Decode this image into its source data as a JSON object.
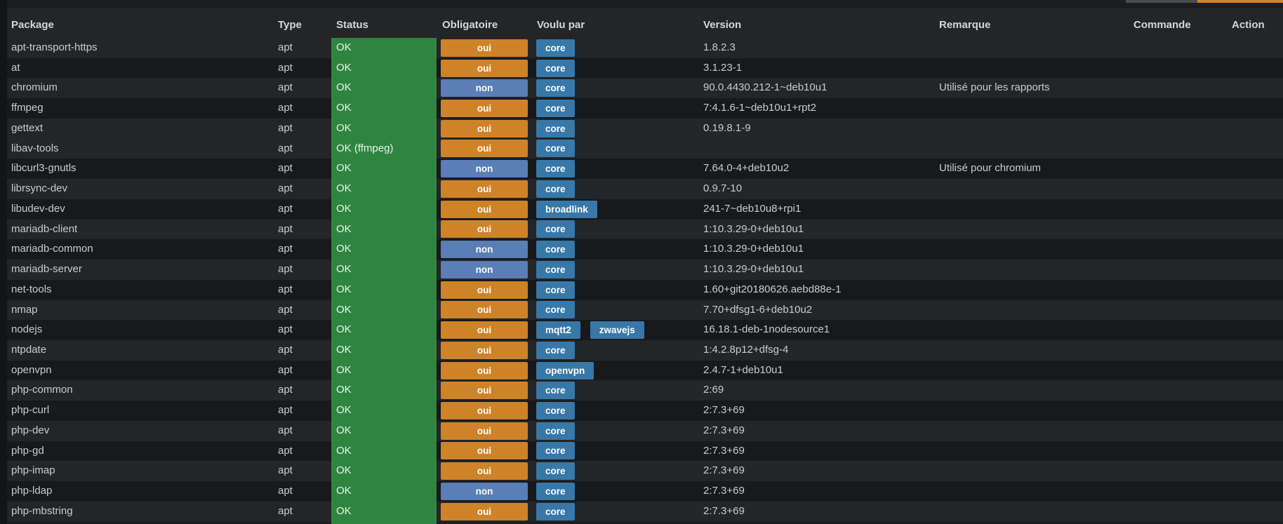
{
  "toolbar": {
    "gray_button_color": "#4a4c4e",
    "orange_button_color": "#cf8228"
  },
  "colors": {
    "page_background": "#131517",
    "table_background": "#1b1d1f",
    "row_light": "#232527",
    "row_dark": "#17191b",
    "status_ok_green": "#2f8540",
    "badge_oui_orange": "#ce8329",
    "badge_non_blue": "#5a7eb5",
    "badge_wanted_blue": "#3878a8",
    "text": "#c9cbce",
    "header_text": "#d4d6d8"
  },
  "table": {
    "columns": [
      {
        "key": "package",
        "label": "Package"
      },
      {
        "key": "type",
        "label": "Type"
      },
      {
        "key": "status",
        "label": "Status"
      },
      {
        "key": "obligatoire",
        "label": "Obligatoire"
      },
      {
        "key": "voulu_par",
        "label": "Voulu par"
      },
      {
        "key": "version",
        "label": "Version"
      },
      {
        "key": "remarque",
        "label": "Remarque"
      },
      {
        "key": "commande",
        "label": "Commande"
      },
      {
        "key": "action",
        "label": "Action"
      }
    ],
    "rows": [
      {
        "package": "apt-transport-https",
        "type": "apt",
        "status": "OK",
        "obligatoire": "oui",
        "voulu_par": [
          "core"
        ],
        "version": "1.8.2.3",
        "remarque": "",
        "commande": "",
        "action": ""
      },
      {
        "package": "at",
        "type": "apt",
        "status": "OK",
        "obligatoire": "oui",
        "voulu_par": [
          "core"
        ],
        "version": "3.1.23-1",
        "remarque": "",
        "commande": "",
        "action": ""
      },
      {
        "package": "chromium",
        "type": "apt",
        "status": "OK",
        "obligatoire": "non",
        "voulu_par": [
          "core"
        ],
        "version": "90.0.4430.212-1~deb10u1",
        "remarque": "Utilisé pour les rapports",
        "commande": "",
        "action": ""
      },
      {
        "package": "ffmpeg",
        "type": "apt",
        "status": "OK",
        "obligatoire": "oui",
        "voulu_par": [
          "core"
        ],
        "version": "7:4.1.6-1~deb10u1+rpt2",
        "remarque": "",
        "commande": "",
        "action": ""
      },
      {
        "package": "gettext",
        "type": "apt",
        "status": "OK",
        "obligatoire": "oui",
        "voulu_par": [
          "core"
        ],
        "version": "0.19.8.1-9",
        "remarque": "",
        "commande": "",
        "action": ""
      },
      {
        "package": "libav-tools",
        "type": "apt",
        "status": "OK (ffmpeg)",
        "obligatoire": "oui",
        "voulu_par": [
          "core"
        ],
        "version": "",
        "remarque": "",
        "commande": "",
        "action": ""
      },
      {
        "package": "libcurl3-gnutls",
        "type": "apt",
        "status": "OK",
        "obligatoire": "non",
        "voulu_par": [
          "core"
        ],
        "version": "7.64.0-4+deb10u2",
        "remarque": "Utilisé pour chromium",
        "commande": "",
        "action": ""
      },
      {
        "package": "librsync-dev",
        "type": "apt",
        "status": "OK",
        "obligatoire": "oui",
        "voulu_par": [
          "core"
        ],
        "version": "0.9.7-10",
        "remarque": "",
        "commande": "",
        "action": ""
      },
      {
        "package": "libudev-dev",
        "type": "apt",
        "status": "OK",
        "obligatoire": "oui",
        "voulu_par": [
          "broadlink"
        ],
        "version": "241-7~deb10u8+rpi1",
        "remarque": "",
        "commande": "",
        "action": ""
      },
      {
        "package": "mariadb-client",
        "type": "apt",
        "status": "OK",
        "obligatoire": "oui",
        "voulu_par": [
          "core"
        ],
        "version": "1:10.3.29-0+deb10u1",
        "remarque": "",
        "commande": "",
        "action": ""
      },
      {
        "package": "mariadb-common",
        "type": "apt",
        "status": "OK",
        "obligatoire": "non",
        "voulu_par": [
          "core"
        ],
        "version": "1:10.3.29-0+deb10u1",
        "remarque": "",
        "commande": "",
        "action": ""
      },
      {
        "package": "mariadb-server",
        "type": "apt",
        "status": "OK",
        "obligatoire": "non",
        "voulu_par": [
          "core"
        ],
        "version": "1:10.3.29-0+deb10u1",
        "remarque": "",
        "commande": "",
        "action": ""
      },
      {
        "package": "net-tools",
        "type": "apt",
        "status": "OK",
        "obligatoire": "oui",
        "voulu_par": [
          "core"
        ],
        "version": "1.60+git20180626.aebd88e-1",
        "remarque": "",
        "commande": "",
        "action": ""
      },
      {
        "package": "nmap",
        "type": "apt",
        "status": "OK",
        "obligatoire": "oui",
        "voulu_par": [
          "core"
        ],
        "version": "7.70+dfsg1-6+deb10u2",
        "remarque": "",
        "commande": "",
        "action": ""
      },
      {
        "package": "nodejs",
        "type": "apt",
        "status": "OK",
        "obligatoire": "oui",
        "voulu_par": [
          "mqtt2",
          "zwavejs"
        ],
        "version": "16.18.1-deb-1nodesource1",
        "remarque": "",
        "commande": "",
        "action": ""
      },
      {
        "package": "ntpdate",
        "type": "apt",
        "status": "OK",
        "obligatoire": "oui",
        "voulu_par": [
          "core"
        ],
        "version": "1:4.2.8p12+dfsg-4",
        "remarque": "",
        "commande": "",
        "action": ""
      },
      {
        "package": "openvpn",
        "type": "apt",
        "status": "OK",
        "obligatoire": "oui",
        "voulu_par": [
          "openvpn"
        ],
        "version": "2.4.7-1+deb10u1",
        "remarque": "",
        "commande": "",
        "action": ""
      },
      {
        "package": "php-common",
        "type": "apt",
        "status": "OK",
        "obligatoire": "oui",
        "voulu_par": [
          "core"
        ],
        "version": "2:69",
        "remarque": "",
        "commande": "",
        "action": ""
      },
      {
        "package": "php-curl",
        "type": "apt",
        "status": "OK",
        "obligatoire": "oui",
        "voulu_par": [
          "core"
        ],
        "version": "2:7.3+69",
        "remarque": "",
        "commande": "",
        "action": ""
      },
      {
        "package": "php-dev",
        "type": "apt",
        "status": "OK",
        "obligatoire": "oui",
        "voulu_par": [
          "core"
        ],
        "version": "2:7.3+69",
        "remarque": "",
        "commande": "",
        "action": ""
      },
      {
        "package": "php-gd",
        "type": "apt",
        "status": "OK",
        "obligatoire": "oui",
        "voulu_par": [
          "core"
        ],
        "version": "2:7.3+69",
        "remarque": "",
        "commande": "",
        "action": ""
      },
      {
        "package": "php-imap",
        "type": "apt",
        "status": "OK",
        "obligatoire": "oui",
        "voulu_par": [
          "core"
        ],
        "version": "2:7.3+69",
        "remarque": "",
        "commande": "",
        "action": ""
      },
      {
        "package": "php-ldap",
        "type": "apt",
        "status": "OK",
        "obligatoire": "non",
        "voulu_par": [
          "core"
        ],
        "version": "2:7.3+69",
        "remarque": "",
        "commande": "",
        "action": ""
      },
      {
        "package": "php-mbstring",
        "type": "apt",
        "status": "OK",
        "obligatoire": "oui",
        "voulu_par": [
          "core"
        ],
        "version": "2:7.3+69",
        "remarque": "",
        "commande": "",
        "action": ""
      }
    ]
  }
}
